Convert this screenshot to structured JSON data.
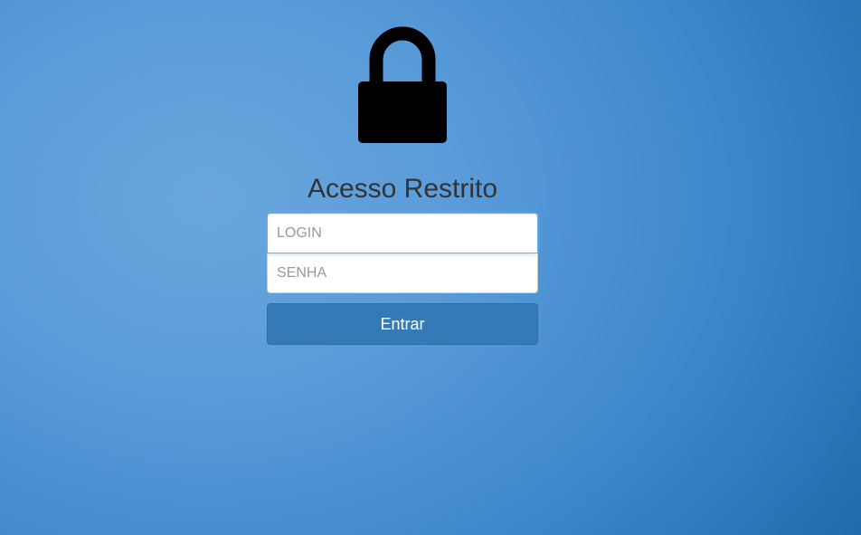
{
  "icons": {
    "lock": "lock-icon"
  },
  "colors": {
    "background_light": "#6aa6dd",
    "background_dark": "#1e66aa",
    "button": "#337ab7",
    "title": "#333333"
  },
  "login_form": {
    "title": "Acesso Restrito",
    "login_placeholder": "LOGIN",
    "login_value": "",
    "password_placeholder": "SENHA",
    "password_value": "",
    "submit_label": "Entrar"
  }
}
